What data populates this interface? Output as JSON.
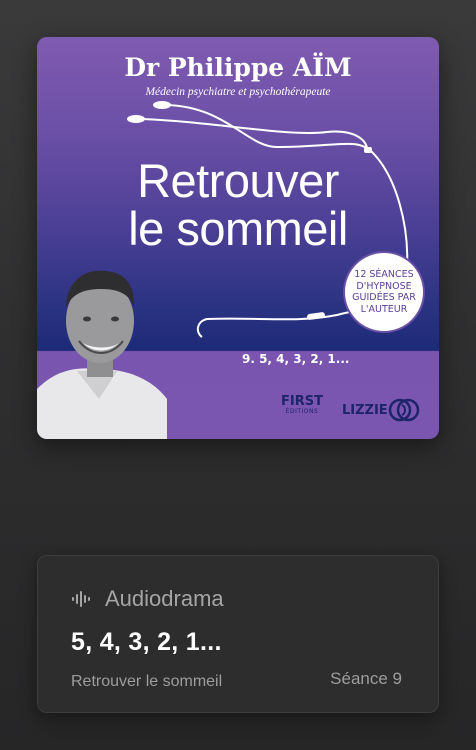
{
  "cover": {
    "author": "Dr Philippe AÏM",
    "subtitle": "Médecin psychiatre et psychothérapeute",
    "title_line1": "Retrouver",
    "title_line2": "le sommeil",
    "badge_lines": [
      "12 SÉANCES",
      "D'HYPNOSE",
      "GUIDÉES PAR",
      "L'AUTEUR"
    ],
    "episode_line": "9. 5, 4, 3, 2, 1...",
    "publisher1": "FIRST",
    "publisher1_sub": "ÉDITIONS",
    "publisher2": "LIZZIE"
  },
  "card": {
    "type_icon": "waveform-icon",
    "type_label": "Audiodrama",
    "episode_title": "5, 4, 3, 2, 1...",
    "show_name": "Retrouver le sommeil",
    "episode_number": "Séance 9"
  }
}
